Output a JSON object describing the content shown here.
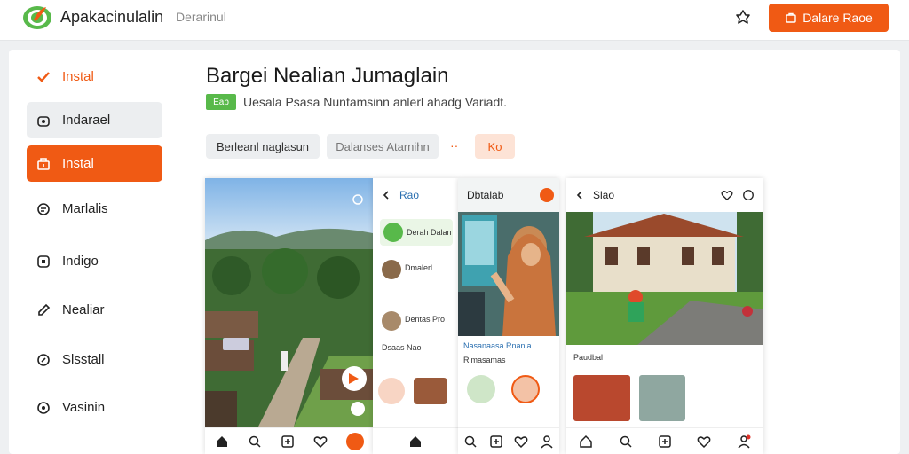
{
  "app": {
    "name": "Apakacinulalin",
    "subtitle": "Derarinul",
    "cta_label": "Dalare Raoe"
  },
  "sidebar": {
    "items": [
      {
        "label": "Instal",
        "icon": "check-icon",
        "style": "accent"
      },
      {
        "label": "Indarael",
        "icon": "cube-icon",
        "style": "gray"
      },
      {
        "label": "Instal",
        "icon": "box-icon",
        "style": "active"
      },
      {
        "label": "Marlalis",
        "icon": "chat-icon",
        "style": "plain"
      },
      {
        "label": "Indigo",
        "icon": "square-icon",
        "style": "plain"
      },
      {
        "label": "Nealiar",
        "icon": "pen-icon",
        "style": "plain"
      },
      {
        "label": "Slsstall",
        "icon": "edit-icon",
        "style": "plain"
      },
      {
        "label": "Vasinin",
        "icon": "message-icon",
        "style": "plain"
      }
    ]
  },
  "main": {
    "title": "Bargei Nealian Jumaglain",
    "tag": "Eab",
    "subtitle": "Uesala Psasa Nuntamsinn anlerl ahadg Variadt.",
    "chips": [
      "Berleanl naglasun",
      "Dalanses Atarnihn",
      "Ko"
    ],
    "more_dots": "··"
  },
  "screens": {
    "screen2": {
      "header": "Rao",
      "line1": "Derah Dalan",
      "line2": "Dmalerl",
      "line3": "Dentas Pro",
      "line4": "Dsaas Nao"
    },
    "screen3": {
      "header": "Dbtalab",
      "caption1": "Nasanaasa Rnanla",
      "caption2": "Rimasamas"
    },
    "screen4": {
      "header": "Slao",
      "caption": "Paudbal"
    }
  },
  "colors": {
    "accent": "#f05a14",
    "green": "#58b94a"
  }
}
